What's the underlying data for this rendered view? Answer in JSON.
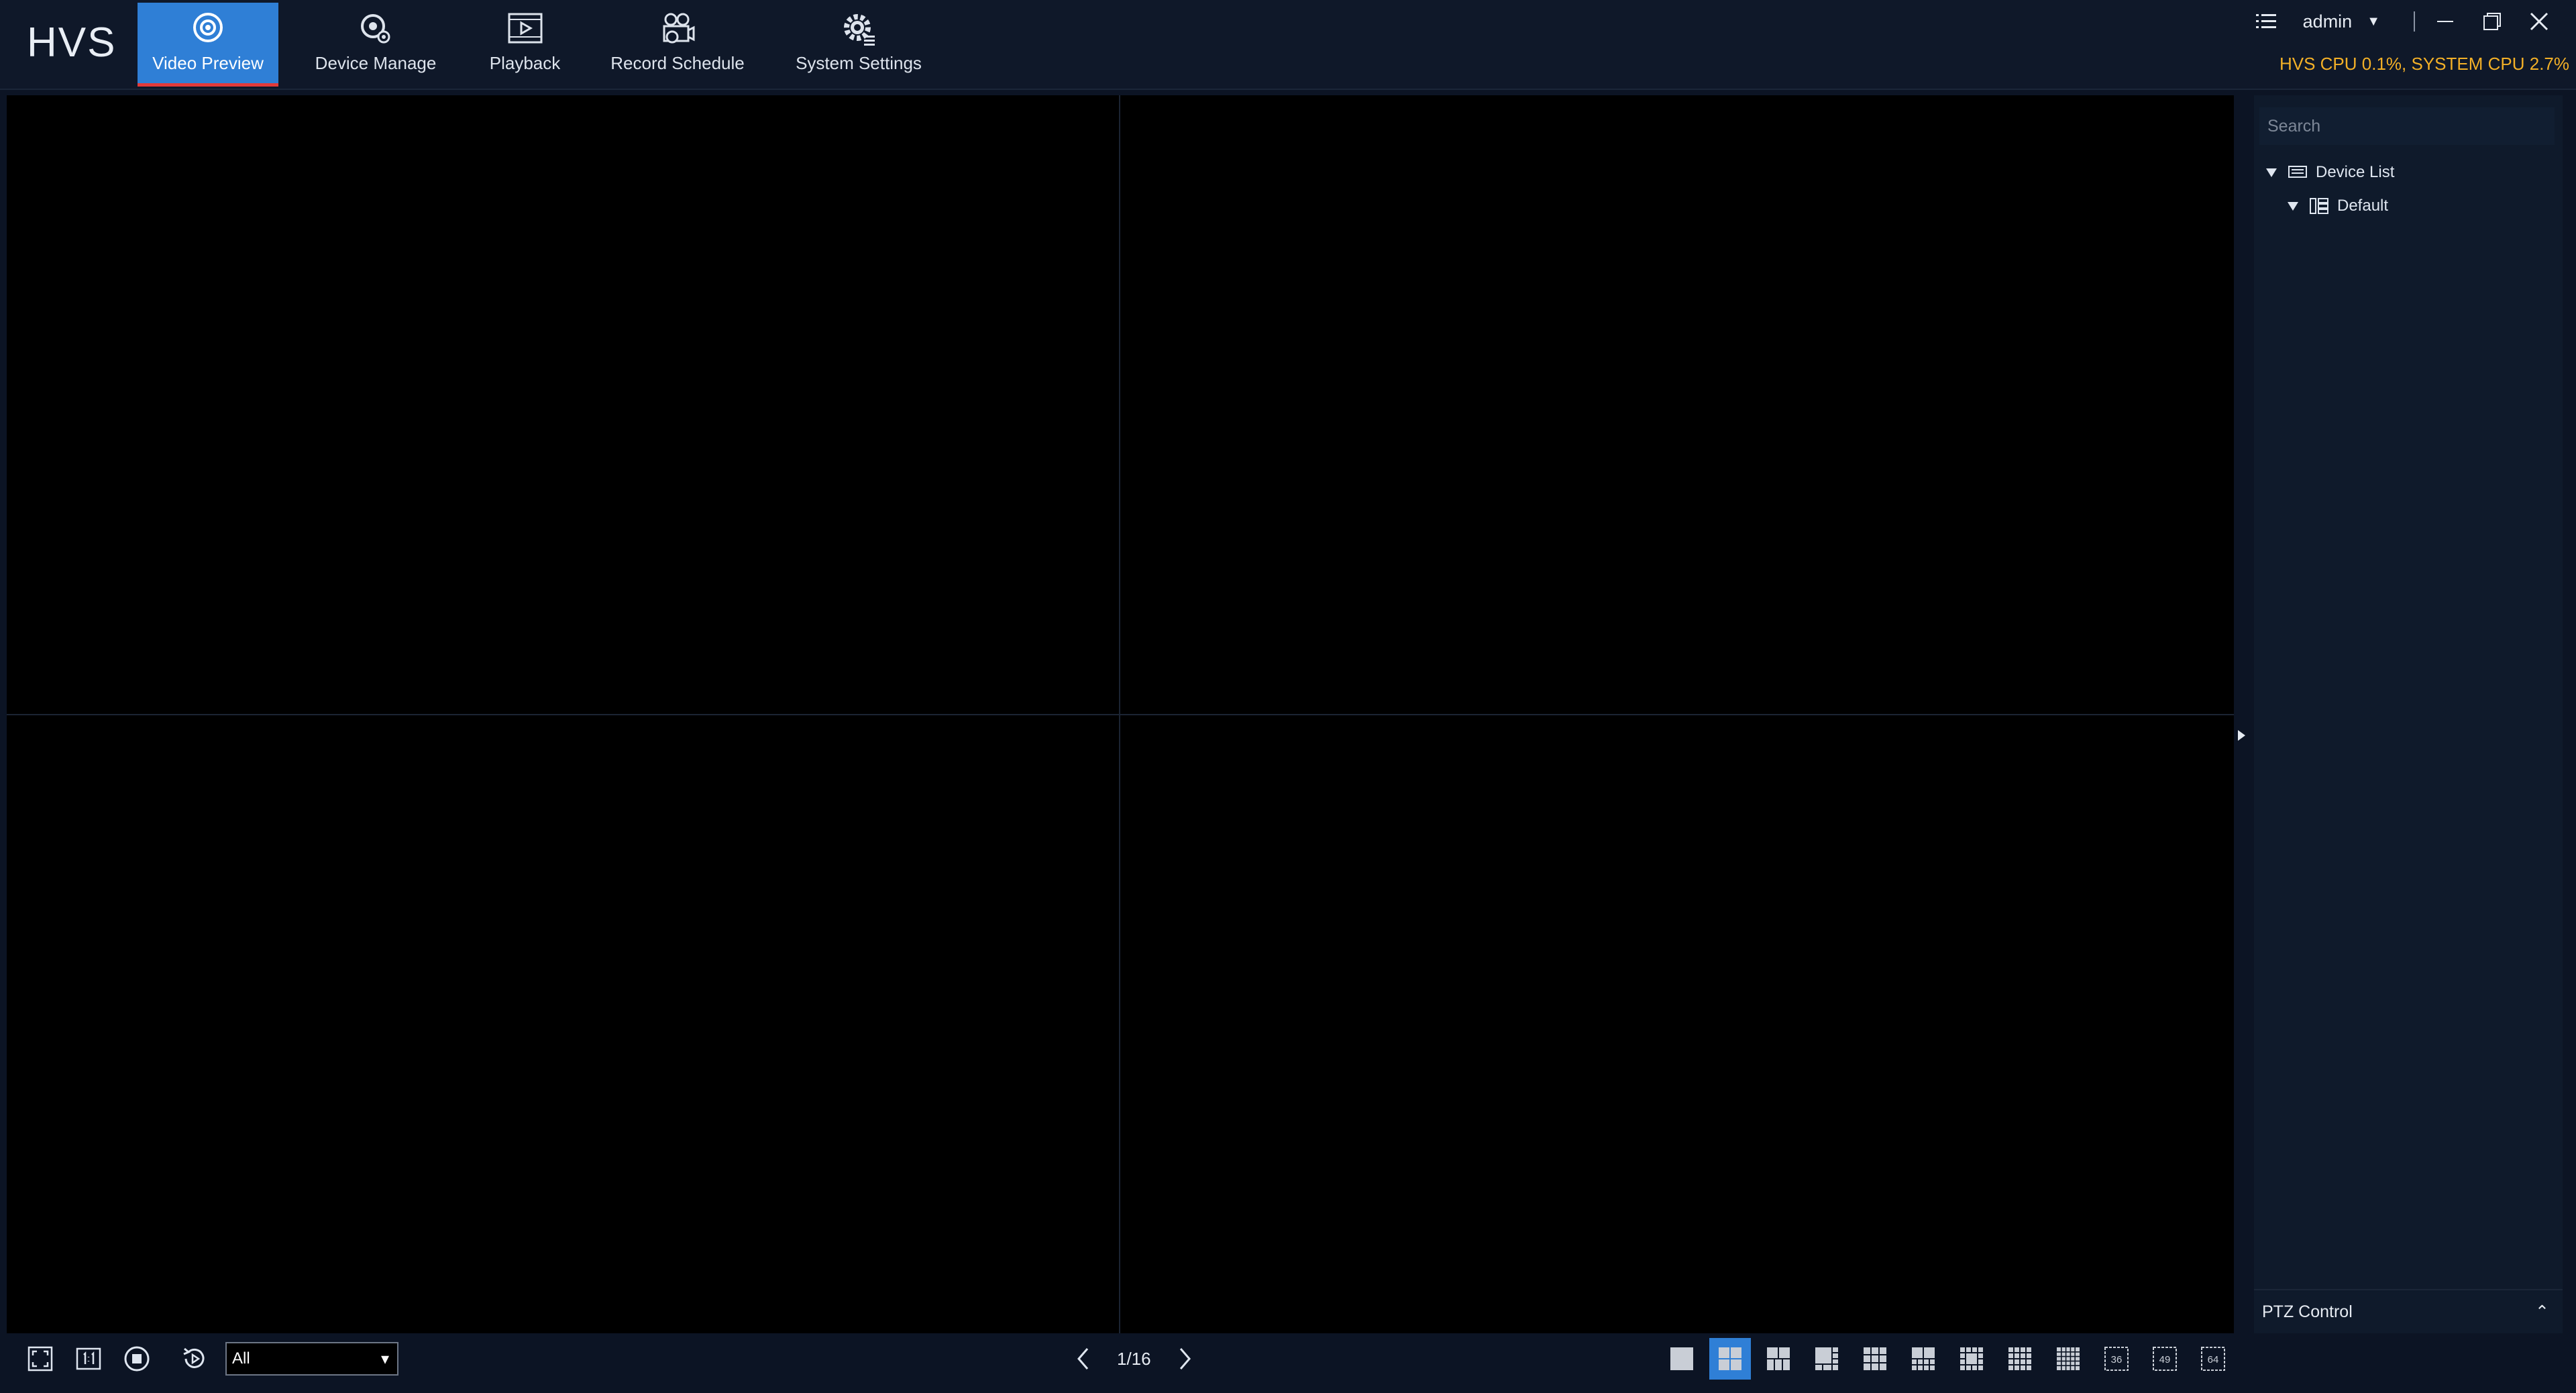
{
  "app": {
    "logo": "HVS"
  },
  "nav": {
    "tabs": [
      {
        "label": "Video Preview",
        "icon": "video-preview-icon",
        "active": true
      },
      {
        "label": "Device Manage",
        "icon": "device-manage-icon",
        "active": false
      },
      {
        "label": "Playback",
        "icon": "playback-icon",
        "active": false
      },
      {
        "label": "Record Schedule",
        "icon": "record-schedule-icon",
        "active": false
      },
      {
        "label": "System Settings",
        "icon": "system-settings-icon",
        "active": false
      }
    ]
  },
  "user": {
    "name": "admin",
    "caret": "▼"
  },
  "status": {
    "cpu": "HVS CPU 0.1%, SYSTEM CPU 2.7%",
    "cpu_color": "#f3b027"
  },
  "colors": {
    "accent": "#2f7fd6",
    "active_underline": "#e23a3a",
    "background": "#0c1424"
  },
  "sidepanel": {
    "search_placeholder": "Search",
    "tree": [
      {
        "label": "Device List",
        "icon": "device-list-icon",
        "expanded": true,
        "level": 0
      },
      {
        "label": "Default",
        "icon": "group-icon",
        "expanded": true,
        "level": 1
      }
    ],
    "ptz_label": "PTZ Control",
    "ptz_caret": "⌃"
  },
  "bottombar": {
    "stream_value": "All",
    "stream_caret": "▾",
    "page": "1/16",
    "active_layout": 2,
    "layouts": [
      "1",
      "4",
      "6",
      "8",
      "9",
      "10",
      "13",
      "16",
      "25",
      "36",
      "49",
      "64"
    ]
  }
}
